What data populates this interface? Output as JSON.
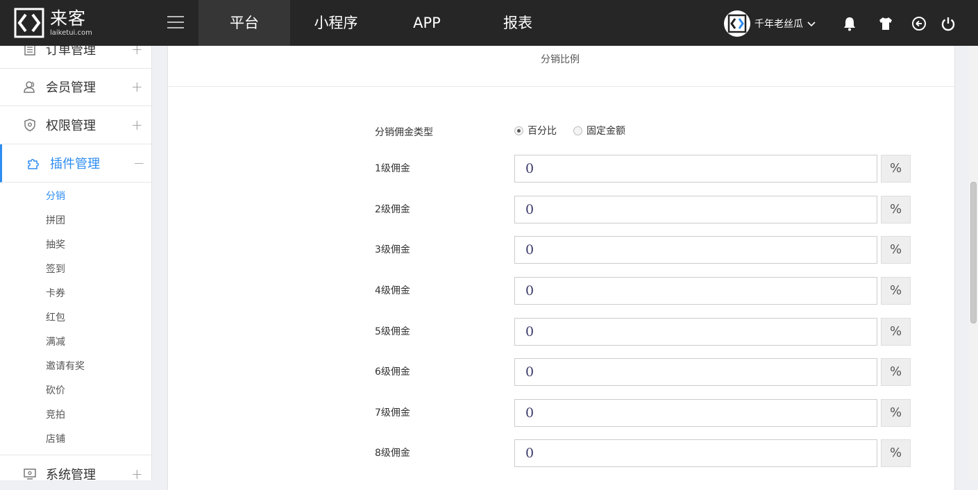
{
  "brand": {
    "name_cn": "来客",
    "domain": "laiketui.com"
  },
  "topnav": {
    "items": [
      {
        "label": "平台",
        "active": true
      },
      {
        "label": "小程序",
        "active": false
      },
      {
        "label": "APP",
        "active": false
      },
      {
        "label": "报表",
        "active": false
      }
    ]
  },
  "user": {
    "name": "千年老丝瓜"
  },
  "top_icons": [
    "menu-icon",
    "bell-icon",
    "shirt-icon",
    "return-icon",
    "power-icon"
  ],
  "sidebar": {
    "menus": [
      {
        "label": "订单管理",
        "icon": "order-list-icon",
        "toggle": "+"
      },
      {
        "label": "会员管理",
        "icon": "users-icon",
        "toggle": "+"
      },
      {
        "label": "权限管理",
        "icon": "shield-icon",
        "toggle": "+"
      },
      {
        "label": "插件管理",
        "icon": "puzzle-icon",
        "toggle": "−",
        "active": true
      },
      {
        "label": "系统管理",
        "icon": "monitor-icon",
        "toggle": "+"
      }
    ],
    "submenu": [
      {
        "label": "分销",
        "active": true
      },
      {
        "label": "拼团"
      },
      {
        "label": "抽奖"
      },
      {
        "label": "签到"
      },
      {
        "label": "卡券"
      },
      {
        "label": "红包"
      },
      {
        "label": "满减"
      },
      {
        "label": "邀请有奖"
      },
      {
        "label": "砍价"
      },
      {
        "label": "竞拍"
      },
      {
        "label": "店铺"
      }
    ]
  },
  "panel": {
    "title": "分销比例",
    "commission_type": {
      "label": "分销佣金类型",
      "options": [
        {
          "label": "百分比",
          "checked": true
        },
        {
          "label": "固定金额",
          "checked": false
        }
      ]
    },
    "levels": [
      {
        "label": "1级佣金",
        "value": "0",
        "unit": "%"
      },
      {
        "label": "2级佣金",
        "value": "0",
        "unit": "%"
      },
      {
        "label": "3级佣金",
        "value": "0",
        "unit": "%"
      },
      {
        "label": "4级佣金",
        "value": "0",
        "unit": "%"
      },
      {
        "label": "5级佣金",
        "value": "0",
        "unit": "%"
      },
      {
        "label": "6级佣金",
        "value": "0",
        "unit": "%"
      },
      {
        "label": "7级佣金",
        "value": "0",
        "unit": "%"
      },
      {
        "label": "8级佣金",
        "value": "0",
        "unit": "%"
      }
    ]
  },
  "colors": {
    "topbar": "#262626",
    "accent": "#2d8cf0"
  }
}
